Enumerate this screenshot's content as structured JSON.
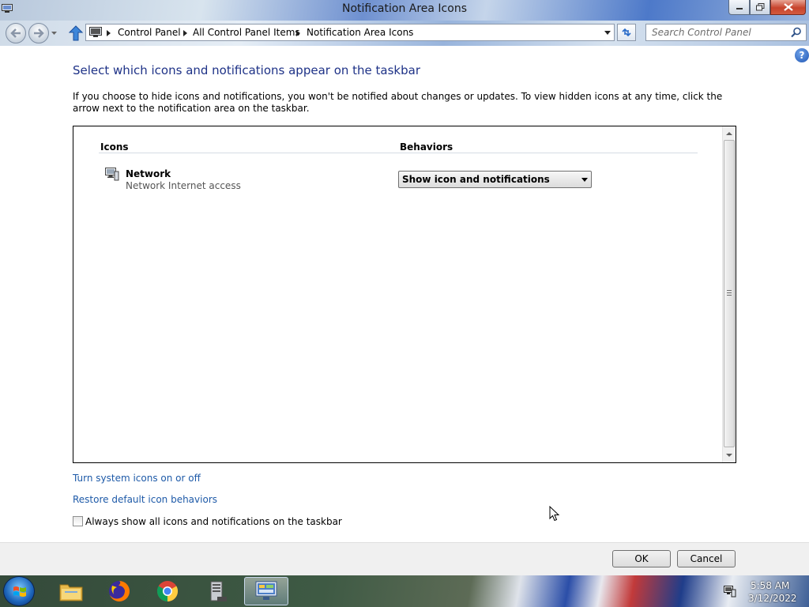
{
  "window": {
    "title": "Notification Area Icons",
    "minimize_icon": "minimize-icon",
    "maximize_icon": "restore-icon",
    "close_icon": "close-icon"
  },
  "navigation": {
    "breadcrumbs": [
      "Control Panel",
      "All Control Panel Items",
      "Notification Area Icons"
    ],
    "search_placeholder": "Search Control Panel"
  },
  "main": {
    "heading": "Select which icons and notifications appear on the taskbar",
    "description": "If you choose to hide icons and notifications, you won't be notified about changes or updates. To view hidden icons at any time, click the arrow next to the notification area on the taskbar.",
    "columns": {
      "icons": "Icons",
      "behaviors": "Behaviors"
    },
    "rows": [
      {
        "name": "Network",
        "subtitle": "Network  Internet access",
        "icon": "network-icon",
        "behavior": "Show icon and notifications"
      }
    ],
    "links": {
      "system_icons": "Turn system icons on or off",
      "restore_defaults": "Restore default icon behaviors"
    },
    "always_show": {
      "label": "Always show all icons and notifications on the taskbar",
      "checked": false
    }
  },
  "footer": {
    "ok": "OK",
    "cancel": "Cancel"
  },
  "taskbar": {
    "items": [
      "file-explorer-icon",
      "firefox-icon",
      "chrome-icon",
      "server-manager-icon",
      "control-panel-icon"
    ],
    "clock": {
      "time": "5:58 AM",
      "date": "3/12/2022"
    }
  },
  "colors": {
    "heading": "#1e3287",
    "link": "#1e5aa8",
    "close_button": "#c7432c"
  }
}
